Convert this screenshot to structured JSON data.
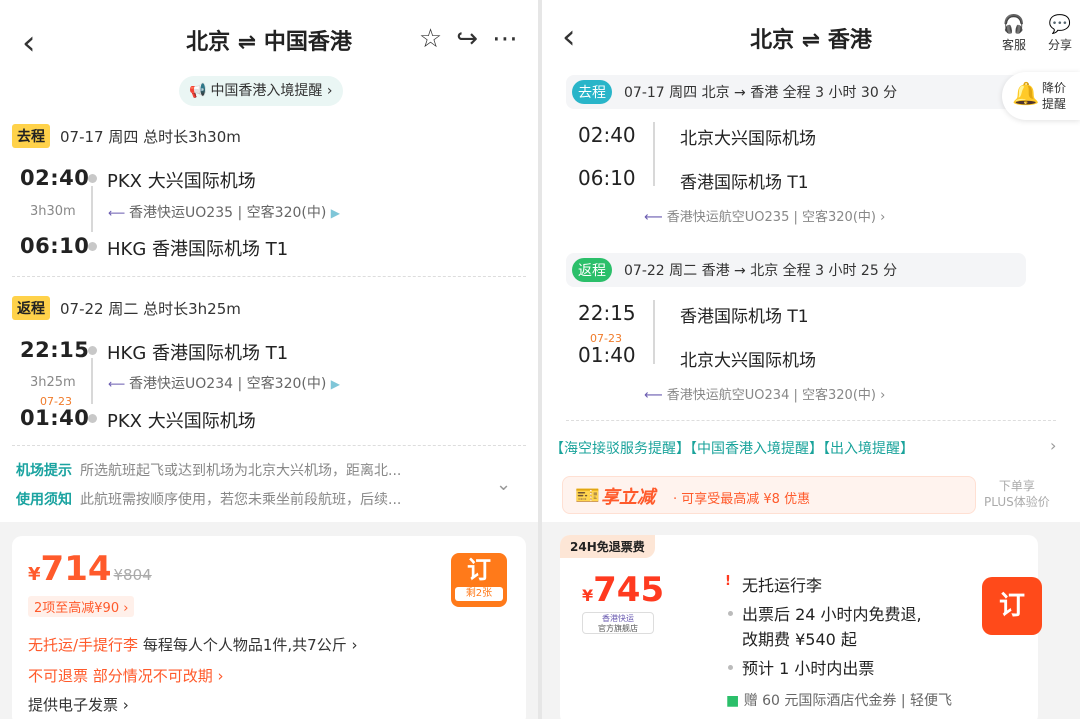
{
  "left": {
    "title": "北京 ⇌ 中国香港",
    "notice": "中国香港入境提醒",
    "outbound": {
      "tag": "去程",
      "header": "07-17 周四 总时长3h30m",
      "dep_time": "02:40",
      "dep_airport": "PKX 大兴国际机场",
      "duration": "3h30m",
      "flight": "香港快运UO235",
      "aircraft": "空客320(中)",
      "arr_time": "06:10",
      "arr_airport": "HKG 香港国际机场 T1"
    },
    "return": {
      "tag": "返程",
      "header": "07-22 周二 总时长3h25m",
      "dep_time": "22:15",
      "dep_airport": "HKG 香港国际机场 T1",
      "duration": "3h25m",
      "flight": "香港快运UO234",
      "aircraft": "空客320(中)",
      "next_day": "07-23",
      "arr_time": "01:40",
      "arr_airport": "PKX 大兴国际机场"
    },
    "airport_tip_label": "机场提示",
    "airport_tip": "所选航班起飞或达到机场为北京大兴机场，距离北...",
    "usage_label": "使用须知",
    "usage": "此航班需按顺序使用，若您未乘坐前段航班，后续...",
    "price": "714",
    "currency": "¥",
    "old_price": "¥804",
    "discount": "2项至高减¥90",
    "book": "订",
    "remaining": "剩2张",
    "baggage_red": "无托运/手提行李",
    "baggage_gray": "每程每人个人物品1件,共7公斤",
    "refund_red": "不可退票 部分情况不可改期",
    "invoice": "提供电子发票"
  },
  "right": {
    "title": "北京 ⇌ 香港",
    "service": "客服",
    "share": "分享",
    "price_alert": [
      "降价",
      "提醒"
    ],
    "outbound": {
      "tag": "去程",
      "info": "07-17 周四   北京 → 香港   全程 3 小时 30 分",
      "dep_time": "02:40",
      "dep_airport": "北京大兴国际机场",
      "arr_time": "06:10",
      "arr_airport": "香港国际机场 T1",
      "flight": "香港快运航空UO235",
      "aircraft": "空客320(中)"
    },
    "return": {
      "tag": "返程",
      "info": "07-22 周二   香港 → 北京   全程 3 小时 25 分",
      "dep_time": "22:15",
      "dep_airport": "香港国际机场 T1",
      "next_day": "07-23",
      "arr_time": "01:40",
      "arr_airport": "北京大兴国际机场",
      "flight": "香港快运航空UO234",
      "aircraft": "空客320(中)"
    },
    "reminders": "【海空接驳服务提醒】【中国香港入境提醒】【出入境提醒】",
    "coupon_big": "享立减",
    "coupon_small": "· 可享受最高减 ¥8 优惠",
    "plus_line1": "下单享",
    "plus_line2": "PLUS体验价",
    "tag24": "24H免退票费",
    "currency": "¥",
    "price": "745",
    "airline_logo": "香港快运",
    "airline_sub": "官方旗舰店",
    "rule1": "无托运行李",
    "rule2": "出票后 24 小时内免费退,",
    "rule2b": "改期费 ¥540 起",
    "rule3": "预计 1 小时内出票",
    "book": "订",
    "gift": "赠 60 元国际酒店代金券 | 轻便飞"
  }
}
